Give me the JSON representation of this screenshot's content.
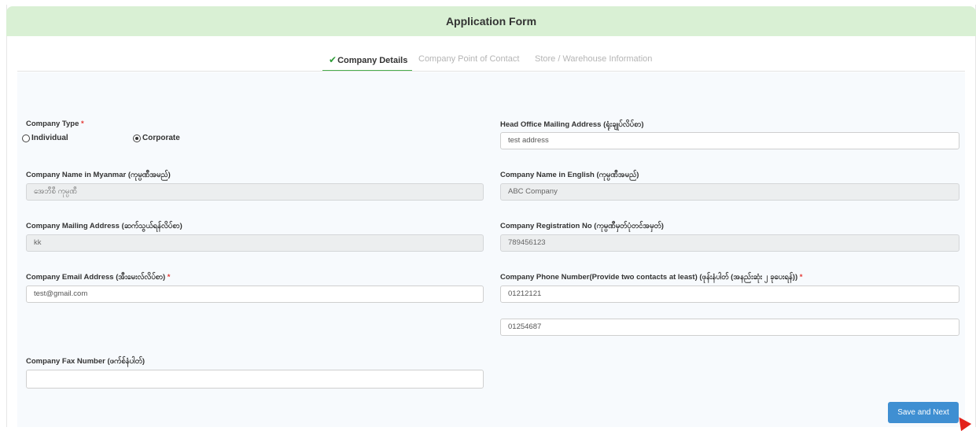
{
  "header": {
    "title": "Application Form"
  },
  "tabs": [
    {
      "label": "Company Details",
      "active": true
    },
    {
      "label": "Company Point of Contact",
      "active": false
    },
    {
      "label": "Store / Warehouse Information",
      "active": false
    }
  ],
  "form": {
    "company_type": {
      "label": "Company Type",
      "required_mark": "*",
      "options": [
        "Individual",
        "Corporate"
      ],
      "selected": "Corporate"
    },
    "head_office": {
      "label": "Head Office Mailing Address (ရုံးချုပ်လိပ်စာ)",
      "value": "test address"
    },
    "name_mm": {
      "label": "Company Name in Myanmar (ကုမ္ပဏီအမည်)",
      "value": "အေဘီစီ ကုမ္ပဏီ"
    },
    "name_en": {
      "label": "Company Name in English (ကုမ္ပဏီအမည်)",
      "value": "ABC Company"
    },
    "mailing": {
      "label": "Company Mailing Address (ဆက်သွယ်ရန်လိပ်စာ)",
      "value": "kk"
    },
    "reg_no": {
      "label": "Company Registration No (ကုမ္ပဏီမှတ်ပုံတင်အမှတ်)",
      "value": "789456123"
    },
    "email": {
      "label": "Company Email Address (အီးမေးလ်လိပ်စာ)",
      "required_mark": "*",
      "value": "test@gmail.com"
    },
    "phone": {
      "label": "Company Phone Number(Provide two contacts at least) (ဖုန်းနံပါတ် (အနည်းဆုံး ၂ ခုပေးရန်))",
      "required_mark": "*",
      "value1": "01212121",
      "value2": "01254687"
    },
    "fax": {
      "label": "Company Fax Number (ဖက်စ်နံပါတ်)",
      "value": ""
    }
  },
  "actions": {
    "save_next": "Save and Next"
  },
  "colors": {
    "header_bg": "#d9f0d4",
    "active_tab": "#4caf50",
    "button": "#3f8fd2",
    "required": "#e53935"
  }
}
